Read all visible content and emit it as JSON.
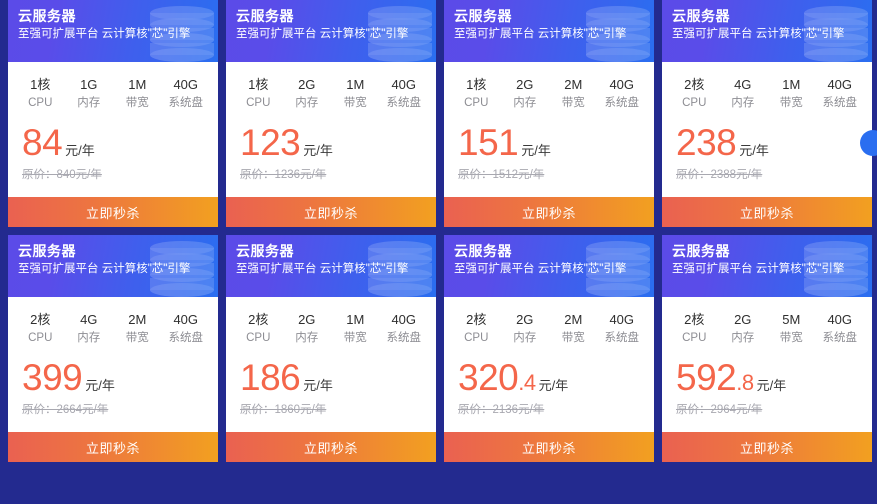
{
  "page": {
    "background_color": "#232a8f",
    "header_gradient": [
      "#5b4be8",
      "#2a6ef0"
    ],
    "button_gradient": [
      "#ea6151",
      "#f2a020"
    ],
    "price_color": "#f4664a"
  },
  "common": {
    "title": "云服务器",
    "subtitle": "至强可扩展平台 云计算核\"芯\"引擎",
    "buy_label": "立即秒杀",
    "spec_labels": [
      "CPU",
      "内存",
      "带宽",
      "系统盘"
    ],
    "price_unit": "元/年",
    "orig_prefix": "原价：",
    "orig_suffix": "元/年"
  },
  "cards": [
    {
      "title": "云服务器",
      "subtitle": "至强可扩展平台 云计算核\"芯\"引擎",
      "specs": [
        {
          "value": "1核",
          "label": "CPU"
        },
        {
          "value": "1G",
          "label": "内存"
        },
        {
          "value": "1M",
          "label": "带宽"
        },
        {
          "value": "40G",
          "label": "系统盘"
        }
      ],
      "price_int": "84",
      "price_dec": "",
      "price_unit": "元/年",
      "orig_price": "原价：840元/年",
      "buy_label": "立即秒杀"
    },
    {
      "title": "云服务器",
      "subtitle": "至强可扩展平台 云计算核\"芯\"引擎",
      "specs": [
        {
          "value": "1核",
          "label": "CPU"
        },
        {
          "value": "2G",
          "label": "内存"
        },
        {
          "value": "1M",
          "label": "带宽"
        },
        {
          "value": "40G",
          "label": "系统盘"
        }
      ],
      "price_int": "123",
      "price_dec": "",
      "price_unit": "元/年",
      "orig_price": "原价：1236元/年",
      "buy_label": "立即秒杀"
    },
    {
      "title": "云服务器",
      "subtitle": "至强可扩展平台 云计算核\"芯\"引擎",
      "specs": [
        {
          "value": "1核",
          "label": "CPU"
        },
        {
          "value": "2G",
          "label": "内存"
        },
        {
          "value": "2M",
          "label": "带宽"
        },
        {
          "value": "40G",
          "label": "系统盘"
        }
      ],
      "price_int": "151",
      "price_dec": "",
      "price_unit": "元/年",
      "orig_price": "原价：1512元/年",
      "buy_label": "立即秒杀"
    },
    {
      "title": "云服务器",
      "subtitle": "至强可扩展平台 云计算核\"芯\"引擎",
      "specs": [
        {
          "value": "2核",
          "label": "CPU"
        },
        {
          "value": "4G",
          "label": "内存"
        },
        {
          "value": "1M",
          "label": "带宽"
        },
        {
          "value": "40G",
          "label": "系统盘"
        }
      ],
      "price_int": "238",
      "price_dec": "",
      "price_unit": "元/年",
      "orig_price": "原价：2388元/年",
      "buy_label": "立即秒杀"
    },
    {
      "title": "云服务器",
      "subtitle": "至强可扩展平台 云计算核\"芯\"引擎",
      "specs": [
        {
          "value": "2核",
          "label": "CPU"
        },
        {
          "value": "4G",
          "label": "内存"
        },
        {
          "value": "2M",
          "label": "带宽"
        },
        {
          "value": "40G",
          "label": "系统盘"
        }
      ],
      "price_int": "399",
      "price_dec": "",
      "price_unit": "元/年",
      "orig_price": "原价：2664元/年",
      "buy_label": "立即秒杀"
    },
    {
      "title": "云服务器",
      "subtitle": "至强可扩展平台 云计算核\"芯\"引擎",
      "specs": [
        {
          "value": "2核",
          "label": "CPU"
        },
        {
          "value": "2G",
          "label": "内存"
        },
        {
          "value": "1M",
          "label": "带宽"
        },
        {
          "value": "40G",
          "label": "系统盘"
        }
      ],
      "price_int": "186",
      "price_dec": "",
      "price_unit": "元/年",
      "orig_price": "原价：1860元/年",
      "buy_label": "立即秒杀"
    },
    {
      "title": "云服务器",
      "subtitle": "至强可扩展平台 云计算核\"芯\"引擎",
      "specs": [
        {
          "value": "2核",
          "label": "CPU"
        },
        {
          "value": "2G",
          "label": "内存"
        },
        {
          "value": "2M",
          "label": "带宽"
        },
        {
          "value": "40G",
          "label": "系统盘"
        }
      ],
      "price_int": "320",
      "price_dec": ".4",
      "price_unit": "元/年",
      "orig_price": "原价：2136元/年",
      "buy_label": "立即秒杀"
    },
    {
      "title": "云服务器",
      "subtitle": "至强可扩展平台 云计算核\"芯\"引擎",
      "specs": [
        {
          "value": "2核",
          "label": "CPU"
        },
        {
          "value": "2G",
          "label": "内存"
        },
        {
          "value": "5M",
          "label": "带宽"
        },
        {
          "value": "40G",
          "label": "系统盘"
        }
      ],
      "price_int": "592",
      "price_dec": ".8",
      "price_unit": "元/年",
      "orig_price": "原价：2964元/年",
      "buy_label": "立即秒杀"
    }
  ]
}
